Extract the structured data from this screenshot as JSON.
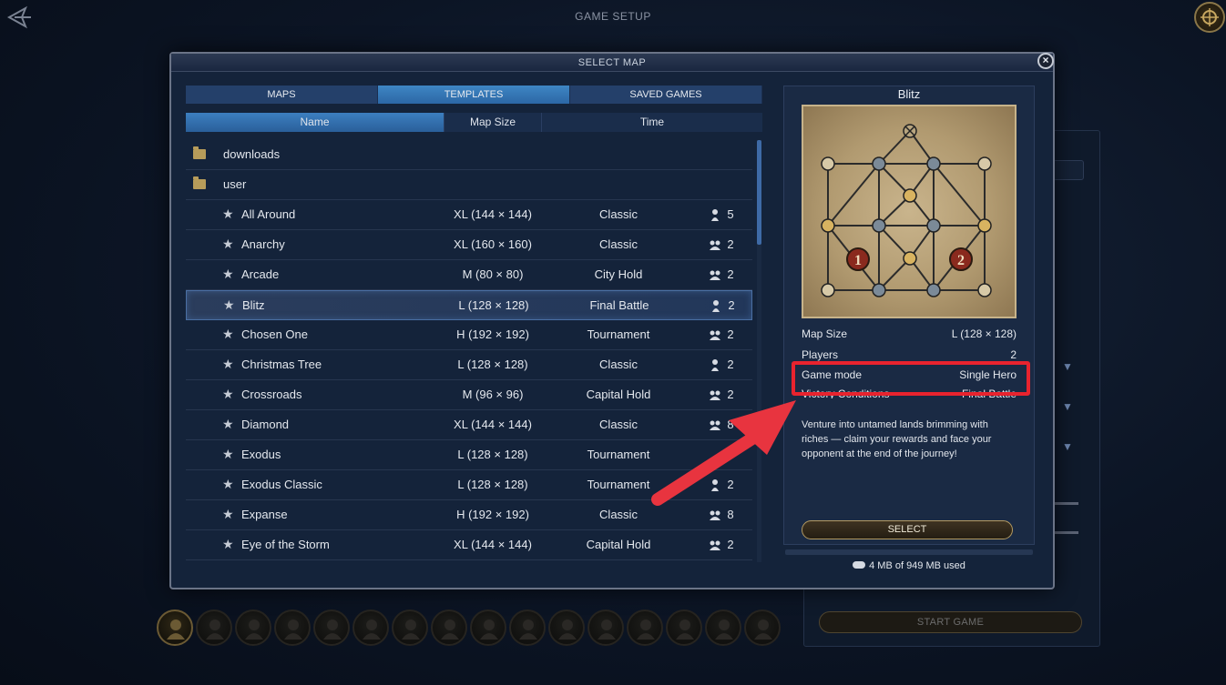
{
  "header": {
    "title": "GAME SETUP"
  },
  "dialog": {
    "title": "SELECT MAP",
    "tabs": [
      {
        "label": "MAPS"
      },
      {
        "label": "TEMPLATES"
      },
      {
        "label": "SAVED GAMES"
      }
    ],
    "active_tab": "TEMPLATES",
    "columns": [
      {
        "label": "Name"
      },
      {
        "label": "Map Size"
      },
      {
        "label": "Time"
      }
    ],
    "folders": [
      {
        "name": "downloads"
      },
      {
        "name": "user"
      }
    ],
    "maps": [
      {
        "name": "All Around",
        "size": "XL (144 × 144)",
        "mode": "Classic",
        "players": "5",
        "icon": "hero-icon"
      },
      {
        "name": "Anarchy",
        "size": "XL (160 × 160)",
        "mode": "Classic",
        "players": "2",
        "icon": "team-icon"
      },
      {
        "name": "Arcade",
        "size": "M (80 × 80)",
        "mode": "City Hold",
        "players": "2",
        "icon": "team-icon"
      },
      {
        "name": "Blitz",
        "size": "L (128 × 128)",
        "mode": "Final Battle",
        "players": "2",
        "icon": "hero-icon",
        "selected": true
      },
      {
        "name": "Chosen One",
        "size": "H (192 × 192)",
        "mode": "Tournament",
        "players": "2",
        "icon": "team-icon"
      },
      {
        "name": "Christmas Tree",
        "size": "L (128 × 128)",
        "mode": "Classic",
        "players": "2",
        "icon": "hero-icon"
      },
      {
        "name": "Crossroads",
        "size": "M (96 × 96)",
        "mode": "Capital Hold",
        "players": "2",
        "icon": "team-icon"
      },
      {
        "name": "Diamond",
        "size": "XL (144 × 144)",
        "mode": "Classic",
        "players": "8",
        "icon": "team-icon"
      },
      {
        "name": "Exodus",
        "size": "L (128 × 128)",
        "mode": "Tournament",
        "players": "",
        "icon": ""
      },
      {
        "name": "Exodus Classic",
        "size": "L (128 × 128)",
        "mode": "Tournament",
        "players": "2",
        "icon": "hero-icon"
      },
      {
        "name": "Expanse",
        "size": "H (192 × 192)",
        "mode": "Classic",
        "players": "8",
        "icon": "team-icon"
      },
      {
        "name": "Eye of the Storm",
        "size": "XL (144 × 144)",
        "mode": "Capital Hold",
        "players": "2",
        "icon": "team-icon"
      }
    ]
  },
  "detail": {
    "title": "Blitz",
    "map_size_label": "Map Size",
    "map_size_value": "L (128 × 128)",
    "players_label": "Players",
    "players_value": "2",
    "game_mode_label": "Game mode",
    "game_mode_value": "Single Hero",
    "victory_label": "Victory Conditions",
    "victory_value": "Final Battle",
    "description": "Venture into untamed lands brimming with riches — claim your rewards and face your opponent at the end of the journey!",
    "select_label": "SELECT",
    "storage": "4 MB of 949 MB used",
    "player_markers": [
      "1",
      "2"
    ]
  },
  "side_panel": {
    "start_label": "START GAME"
  },
  "colors": {
    "highlight": "#e8232e",
    "arrow": "#e8343f",
    "active_tab": "#3e86c4"
  }
}
